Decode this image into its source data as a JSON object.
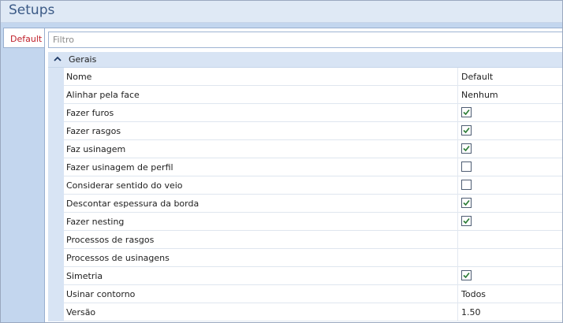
{
  "window": {
    "title": "Setups"
  },
  "tabs": [
    {
      "label": "Default"
    }
  ],
  "filter": {
    "placeholder": "Filtro",
    "value": ""
  },
  "group": {
    "title": "Gerais",
    "expanded": true
  },
  "colors": {
    "accent_tab_text": "#c0202a",
    "group_bg": "#d8e4f4",
    "tab_strip_bg": "#c3d6ee",
    "check_color": "#2d7d37"
  },
  "properties": [
    {
      "name": "Nome",
      "type": "text",
      "value": "Default"
    },
    {
      "name": "Alinhar pela face",
      "type": "text",
      "value": "Nenhum"
    },
    {
      "name": "Fazer furos",
      "type": "check",
      "checked": true
    },
    {
      "name": "Fazer rasgos",
      "type": "check",
      "checked": true
    },
    {
      "name": "Faz usinagem",
      "type": "check",
      "checked": true
    },
    {
      "name": "Fazer usinagem de perfil",
      "type": "check",
      "checked": false
    },
    {
      "name": "Considerar sentido do veio",
      "type": "check",
      "checked": false
    },
    {
      "name": "Descontar espessura da borda",
      "type": "check",
      "checked": true
    },
    {
      "name": "Fazer nesting",
      "type": "check",
      "checked": true
    },
    {
      "name": "Processos de rasgos",
      "type": "text",
      "value": ""
    },
    {
      "name": "Processos de usinagens",
      "type": "text",
      "value": ""
    },
    {
      "name": "Simetria",
      "type": "check",
      "checked": true
    },
    {
      "name": "Usinar contorno",
      "type": "text",
      "value": "Todos"
    },
    {
      "name": "Versão",
      "type": "text",
      "value": "1.50"
    }
  ]
}
